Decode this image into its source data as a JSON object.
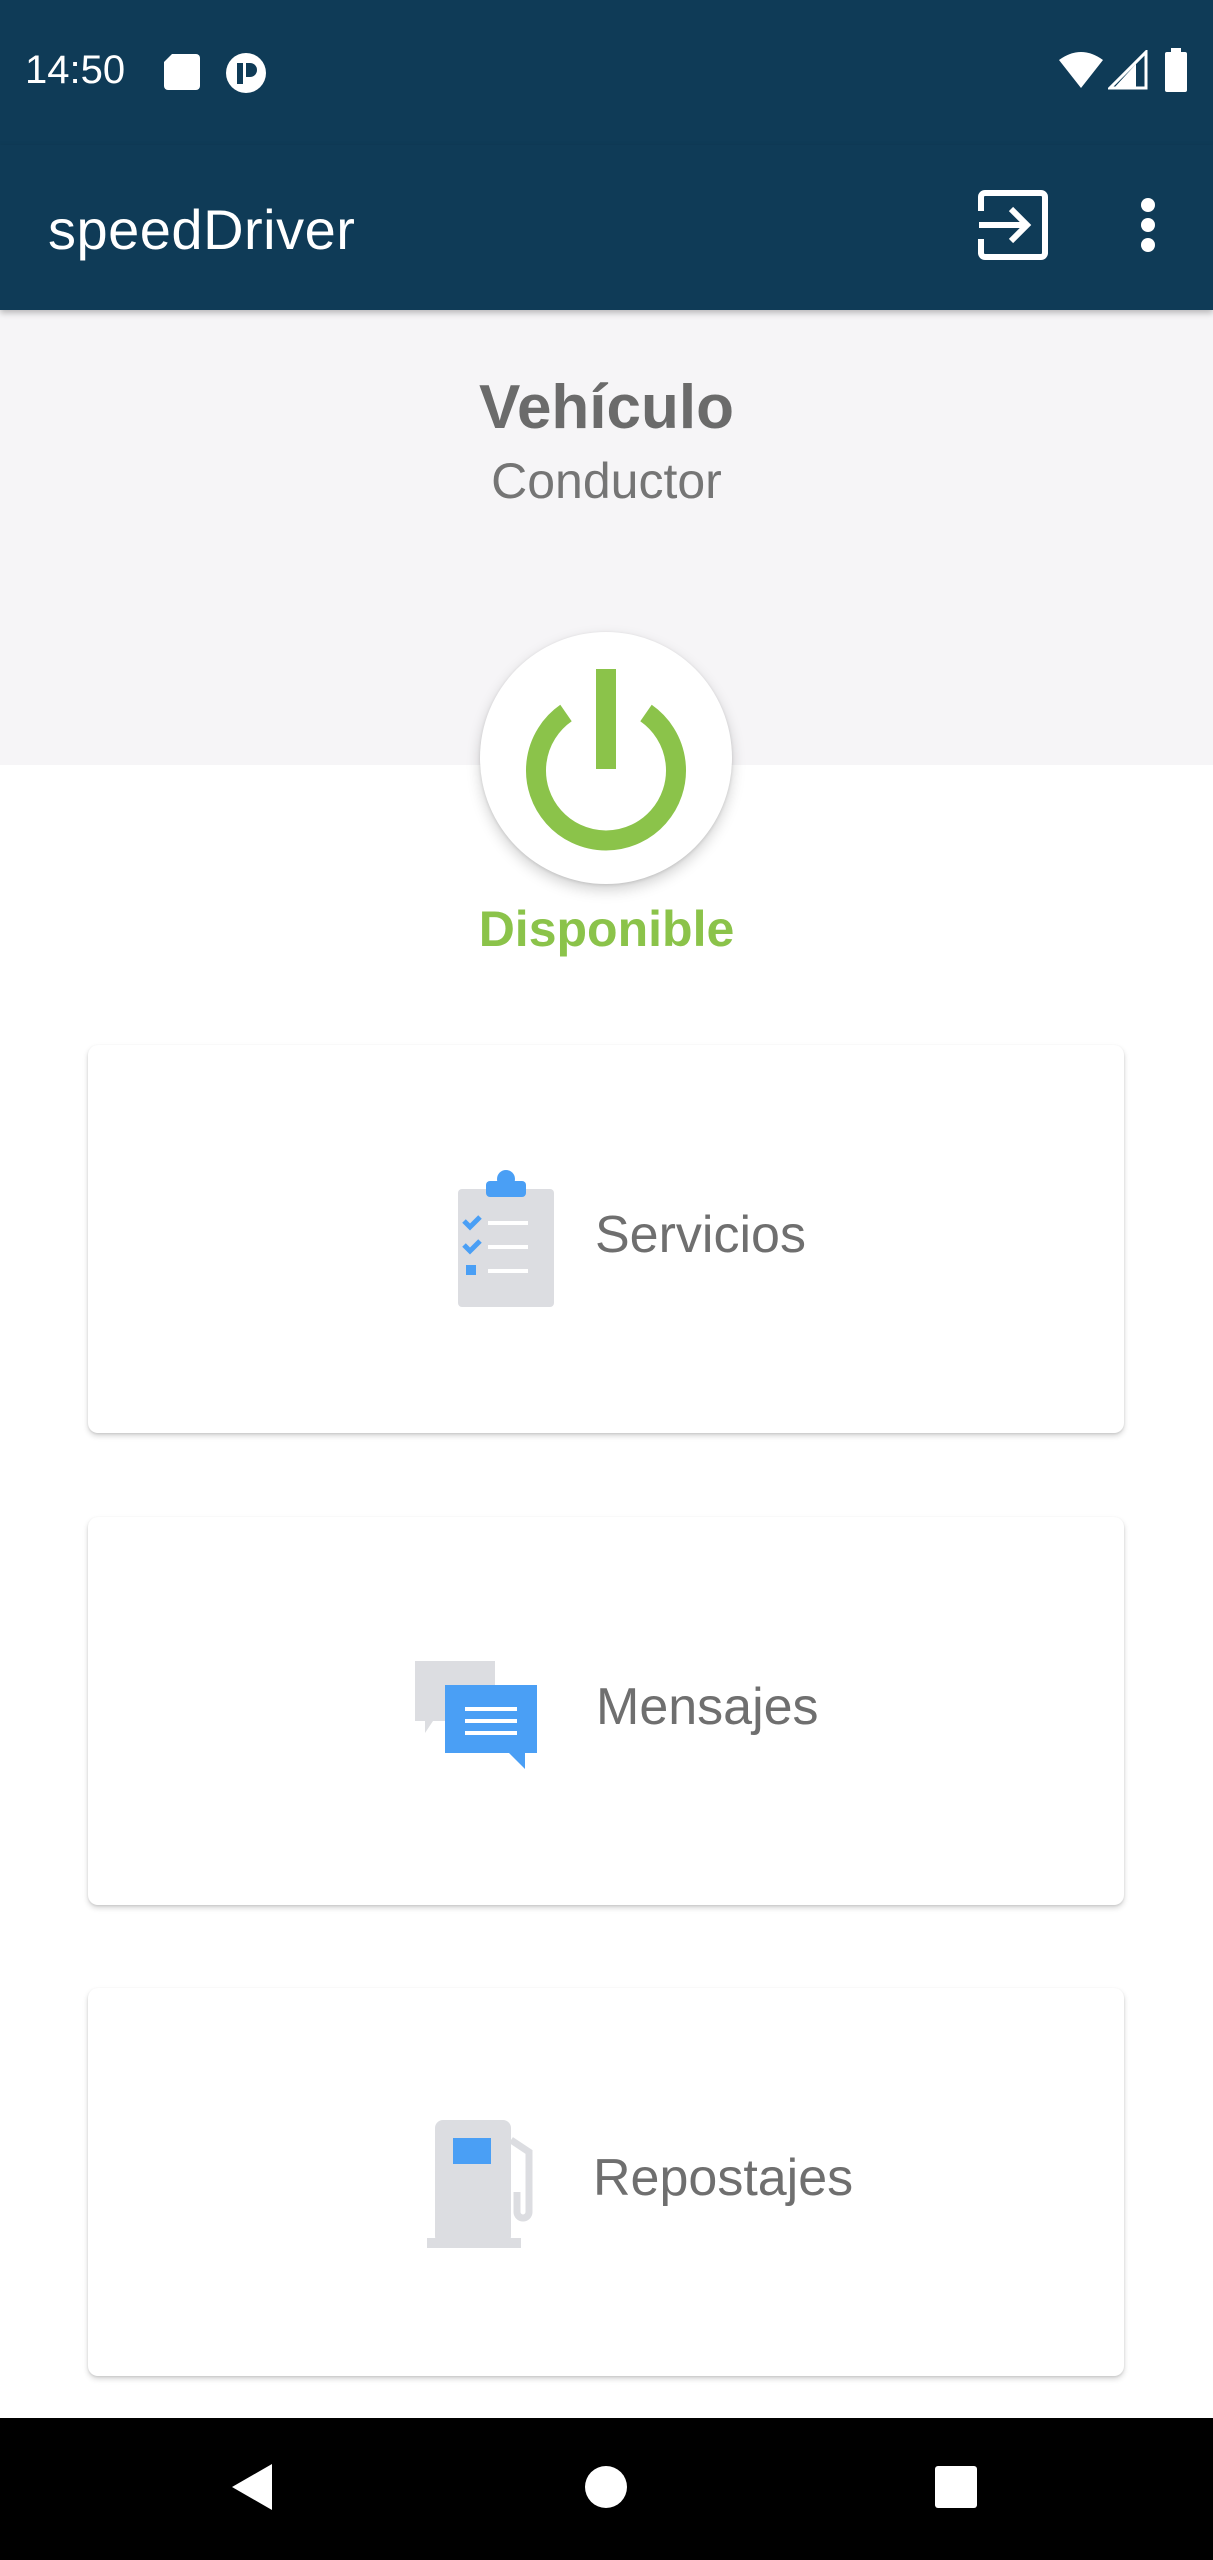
{
  "status_bar": {
    "time": "14:50",
    "left_icons": [
      "sd-card-icon",
      "app-notification-icon"
    ],
    "right_icons": [
      "wifi-icon",
      "cell-signal-icon",
      "battery-icon"
    ]
  },
  "app_bar": {
    "title": "speedDriver",
    "actions": [
      "logout-icon",
      "more-vert-icon"
    ]
  },
  "header": {
    "vehicle_label": "Vehículo",
    "driver_label": "Conductor"
  },
  "availability": {
    "status_text": "Disponible",
    "status_color": "#8bc34a"
  },
  "menu": {
    "items": [
      {
        "label": "Servicios",
        "icon": "clipboard-checklist-icon"
      },
      {
        "label": "Mensajes",
        "icon": "chat-bubbles-icon"
      },
      {
        "label": "Repostajes",
        "icon": "fuel-pump-icon"
      }
    ]
  },
  "colors": {
    "primary": "#0f3b57",
    "accent_green": "#8bc34a",
    "icon_blue": "#4a9ff5",
    "icon_grey": "#dcdde1",
    "header_bg": "#f6f5f7"
  },
  "nav_bar": {
    "buttons": [
      "back-icon",
      "home-icon",
      "recents-icon"
    ]
  }
}
